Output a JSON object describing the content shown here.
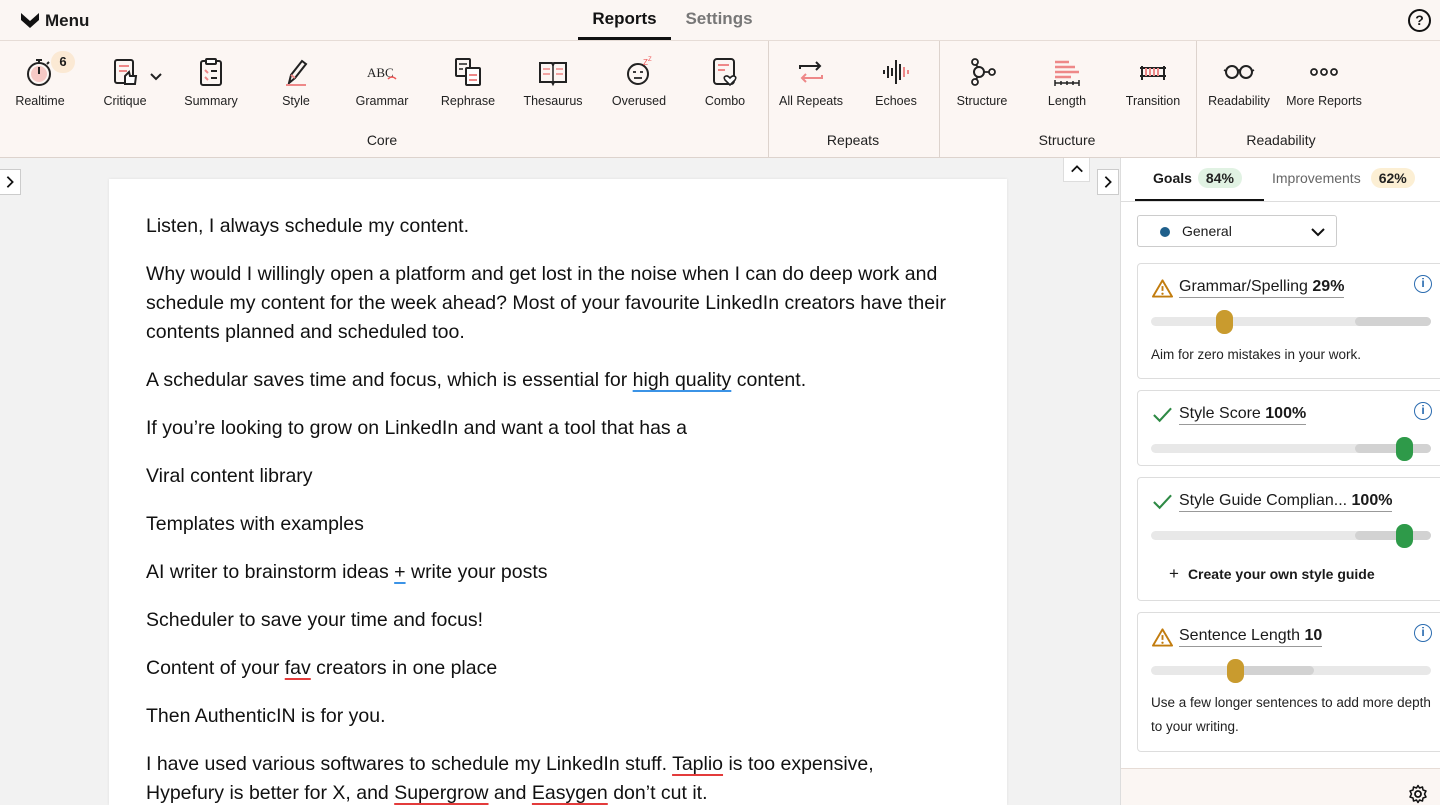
{
  "header": {
    "menu_label": "Menu",
    "tabs": [
      {
        "label": "Reports",
        "active": true
      },
      {
        "label": "Settings",
        "active": false
      }
    ],
    "help_icon": "?"
  },
  "ribbon": {
    "core": {
      "group_label": "Core",
      "buttons": [
        {
          "label": "Realtime",
          "icon": "stopwatch-icon",
          "badge": "6"
        },
        {
          "label": "Critique",
          "icon": "thumbs-up-doc-icon"
        },
        {
          "label": "Summary",
          "icon": "clipboard-icon"
        },
        {
          "label": "Style",
          "icon": "pencil-icon"
        },
        {
          "label": "Grammar",
          "icon": "abc-icon"
        },
        {
          "label": "Rephrase",
          "icon": "rephrase-icon"
        },
        {
          "label": "Thesaurus",
          "icon": "book-icon"
        },
        {
          "label": "Overused",
          "icon": "sleepy-face-icon"
        },
        {
          "label": "Combo",
          "icon": "heart-doc-icon"
        }
      ]
    },
    "repeats": {
      "group_label": "Repeats",
      "buttons": [
        {
          "label": "All Repeats",
          "icon": "repeat-arrows-icon"
        },
        {
          "label": "Echoes",
          "icon": "soundwave-icon"
        }
      ]
    },
    "structure": {
      "group_label": "Structure",
      "buttons": [
        {
          "label": "Structure",
          "icon": "nodes-icon"
        },
        {
          "label": "Length",
          "icon": "bars-icon"
        },
        {
          "label": "Transition",
          "icon": "bridge-icon"
        }
      ]
    },
    "readability": {
      "group_label": "Readability",
      "buttons": [
        {
          "label": "Readability",
          "icon": "glasses-icon"
        },
        {
          "label": "More Reports",
          "icon": "more-dots-icon"
        }
      ]
    }
  },
  "document": {
    "p1": "Listen, I always schedule my content.",
    "p2": "Why would I willingly open a platform and get lost in the noise when I can do deep work and schedule my content for the week ahead? Most of your favourite LinkedIn creators have their contents planned and scheduled too.",
    "p3": {
      "a": "A schedular saves time and focus, which is essential for ",
      "u": "high quality",
      "b": " content."
    },
    "p4": "If you’re looking to grow on LinkedIn and want a tool that has a",
    "p5": "Viral content library",
    "p6": "Templates with examples",
    "p7": {
      "a": "AI writer to brainstorm ideas ",
      "u": "+",
      "b": " write your posts"
    },
    "p8": "Scheduler to save your time and focus!",
    "p9": {
      "a": "Content of your ",
      "u": "fav",
      "b": " creators in one place"
    },
    "p10": "Then AuthenticIN is for you.",
    "p11": {
      "a": "I have used various softwares to schedule my LinkedIn stuff. ",
      "u1": "Taplio",
      "b": " is too expensive, Hypefury is better for X, and ",
      "u2": "Supergrow",
      "c": " and ",
      "u3": "Easygen",
      "d": " don’t cut it."
    }
  },
  "panel": {
    "tabs": {
      "goals_label": "Goals",
      "goals_score": "84%",
      "improvements_label": "Improvements",
      "improvements_score": "62%"
    },
    "dropdown": {
      "value": "General",
      "dot_color": "#1f5f8b"
    },
    "cards": [
      {
        "title": "Grammar/Spelling",
        "score": "29%",
        "status": "warning",
        "level": 0.29,
        "desc": "Aim for zero mistakes in your work."
      },
      {
        "title": "Style Score",
        "score": "100%",
        "status": "ok",
        "level": 1.0
      },
      {
        "title": "Style Guide Complian...",
        "score": "100%",
        "status": "ok",
        "level": 1.0,
        "action": "Create your own style guide"
      },
      {
        "title": "Sentence Length",
        "score": "10",
        "status": "warning",
        "level": 0.3,
        "desc": "Use a few longer sentences to add more depth to your writing."
      }
    ]
  },
  "colors": {
    "accent_amber": "#c99b2e",
    "accent_green": "#2e9a49",
    "info_blue": "#2b6cb0",
    "underline_red": "#e33b3b",
    "underline_blue": "#3b93e6"
  }
}
